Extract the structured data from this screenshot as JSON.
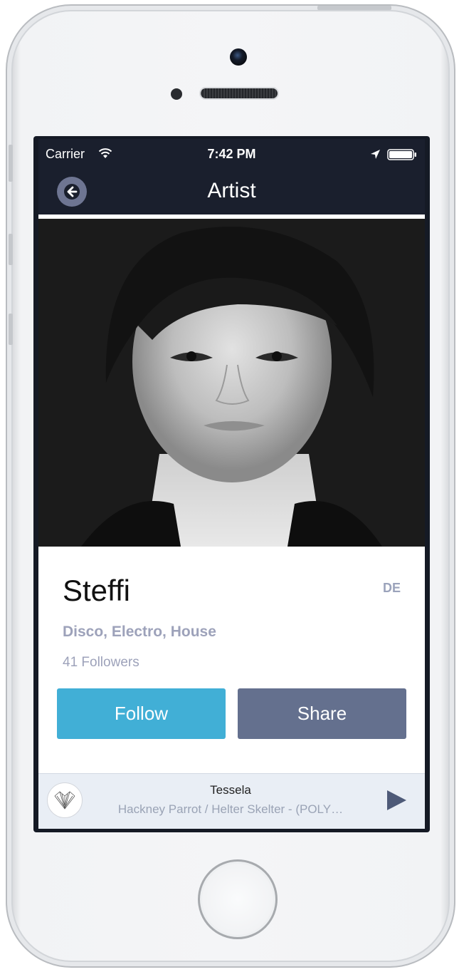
{
  "status_bar": {
    "carrier": "Carrier",
    "time": "7:42 PM"
  },
  "nav": {
    "title": "Artist",
    "back_icon": "back-arrow-icon"
  },
  "artist": {
    "name": "Steffi",
    "country": "DE",
    "genres": "Disco, Electro, House",
    "followers": "41 Followers",
    "photo": "portrait-photo"
  },
  "actions": {
    "follow_label": "Follow",
    "share_label": "Share"
  },
  "now_playing": {
    "title": "Tessela",
    "subtitle": "Hackney Parrot / Helter Skelter - (POLY…",
    "play_icon": "play-icon"
  },
  "colors": {
    "nav_bg": "#1a1f2d",
    "follow": "#41afd6",
    "share": "#64708e",
    "muted_text": "#9da2ba",
    "player_bg": "#e9eef5"
  }
}
